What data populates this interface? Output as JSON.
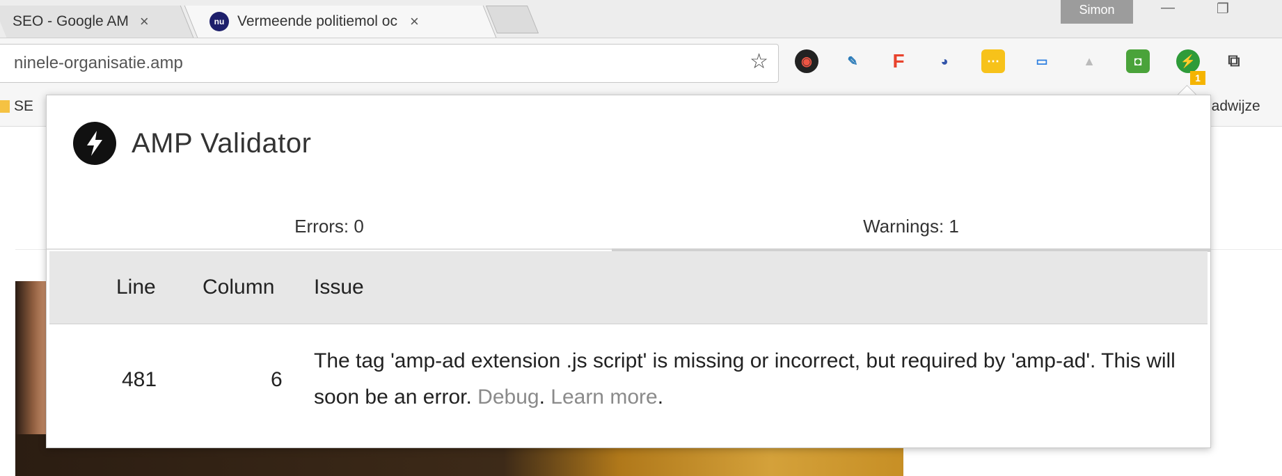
{
  "browser": {
    "tabs": [
      {
        "title": "SEO - Google AM",
        "close": "×"
      },
      {
        "title": "Vermeende politiemol oc",
        "close": "×",
        "favicon": "nu-logo-icon"
      }
    ],
    "profile_name": "Simon",
    "url": "ninele-organisatie.amp",
    "bookmark_left": "SE",
    "bookmark_right": "ladwijze",
    "extension_badge": "1"
  },
  "popup": {
    "title": "AMP Validator",
    "tabs": {
      "errors": "Errors: 0",
      "warnings": "Warnings: 1"
    },
    "table": {
      "headers": {
        "line": "Line",
        "column": "Column",
        "issue": "Issue"
      },
      "rows": [
        {
          "line": "481",
          "column": "6",
          "issue": "The tag 'amp-ad extension .js script' is missing or incorrect, but required by 'amp-ad'. This will soon be an error.",
          "debug_link": "Debug",
          "learn_more_link": "Learn more"
        }
      ]
    }
  },
  "colors": {
    "link": "#8a8a8a",
    "table_header_bg": "#e7e7e7",
    "badge": "#f5b400"
  }
}
